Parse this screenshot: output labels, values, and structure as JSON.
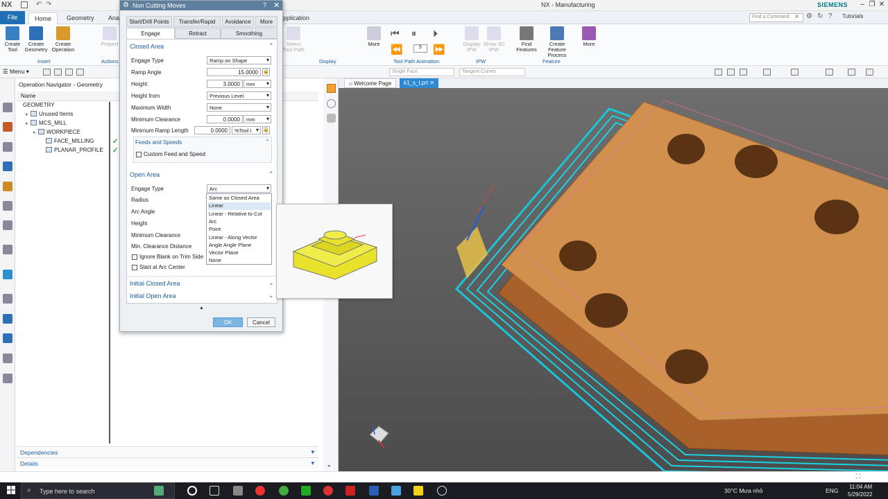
{
  "app": {
    "logo": "NX",
    "title": "NX - Manufacturing",
    "brand": "SIEMENS"
  },
  "ribbon_tabs": [
    "File",
    "Home",
    "Geometry",
    "Anal",
    "pplication"
  ],
  "find_command": "Find a Command",
  "tutorials": "Tutorials",
  "ribbon": {
    "buttons": [
      {
        "label": "Create Tool",
        "color": "#3a7fc2"
      },
      {
        "label": "Create Geometry",
        "color": "#2f6fb8"
      },
      {
        "label": "Create Operation",
        "color": "#d99a2a"
      },
      {
        "label": "Propert",
        "color": "#bfc5cc"
      },
      {
        "label": "Select Tool Path",
        "color": "#bfc5cc"
      },
      {
        "label": "More",
        "color": "#666"
      },
      {
        "label": "Display IPW",
        "color": "#bfc5cc"
      },
      {
        "label": "Show 3D IPW",
        "color": "#bfc5cc"
      },
      {
        "label": "Find Features",
        "color": "#777"
      },
      {
        "label": "Create Feature Process",
        "color": "#4c79b8"
      },
      {
        "label": "More",
        "color": "#9b59b6"
      }
    ],
    "groups": [
      "Insert",
      "Actions",
      "Display",
      "Tool Path Animation",
      "IPW",
      "Feature"
    ],
    "anim_speed": "5"
  },
  "menu_label": "Menu",
  "combos": {
    "face": "Single Face",
    "curves": "Tangent Curves"
  },
  "navigator": {
    "title": "Operation Navigator - Geometry",
    "column": "Name",
    "rows": [
      {
        "label": "GEOMETRY",
        "indent": 0,
        "check": false
      },
      {
        "label": "Unused Items",
        "indent": 1,
        "check": false
      },
      {
        "label": "MCS_MILL",
        "indent": 1,
        "check": false
      },
      {
        "label": "WORKPIECE",
        "indent": 2,
        "check": false
      },
      {
        "label": "FACE_MILLING",
        "indent": 3,
        "check": true
      },
      {
        "label": "PLANAR_PROFILE",
        "indent": 3,
        "check": true
      }
    ],
    "dependencies": "Dependencies",
    "details": "Details"
  },
  "graphics_tabs": [
    "Welcome Page",
    "k1_s_t.prt"
  ],
  "dialog": {
    "title": "Non Cutting Moves",
    "tabs_row1": [
      "Start/Drill Points",
      "Transfer/Rapid",
      "Avoidance",
      "More"
    ],
    "tabs_row2": [
      "Engage",
      "Retract",
      "Smoothing"
    ],
    "closed_area": {
      "title": "Closed Area",
      "engage_type_label": "Engage Type",
      "engage_type": "Ramp on Shape",
      "ramp_angle_label": "Ramp Angle",
      "ramp_angle": "15.0000",
      "height_label": "Height",
      "height": "3.0000",
      "height_unit": "mm",
      "height_from_label": "Height from",
      "height_from": "Previous Level",
      "max_width_label": "Maximum Width",
      "max_width": "None",
      "min_clearance_label": "Minimum Clearance",
      "min_clearance": "0.0000",
      "min_clearance_unit": "mm",
      "min_ramp_label": "Minimum Ramp Length",
      "min_ramp": "0.0000",
      "min_ramp_unit": "%Tool I",
      "feeds_title": "Feeds and Speeds",
      "custom_feed": "Custom Feed and Speed"
    },
    "open_area": {
      "title": "Open Area",
      "engage_type_label": "Engage Type",
      "engage_type": "Arc",
      "radius_label": "Radius",
      "arc_angle_label": "Arc Angle",
      "height_label": "Height",
      "min_clearance_label": "Minimum Clearance",
      "min_clear_dist_label": "Min. Clearance Distance",
      "ignore_blank": "Ignore Blank on Trim Side",
      "start_arc": "Start at Arc Center"
    },
    "initial_closed": "Initial Closed Area",
    "initial_open": "Initial Open Area",
    "ok": "OK",
    "cancel": "Cancel"
  },
  "dropdown_options": [
    "Same as Closed Area",
    "Linear",
    "Linear - Relative to Cut",
    "Arc",
    "Point",
    "Linear - Along Vector",
    "Angle Angle Plane",
    "Vector Plane",
    "None"
  ],
  "dropdown_highlight": 1,
  "taskbar": {
    "search": "Type here to search",
    "weather": "30°C Mưa nhỏ",
    "lang": "ENG",
    "time": "11:04 AM",
    "date": "5/29/2022"
  }
}
